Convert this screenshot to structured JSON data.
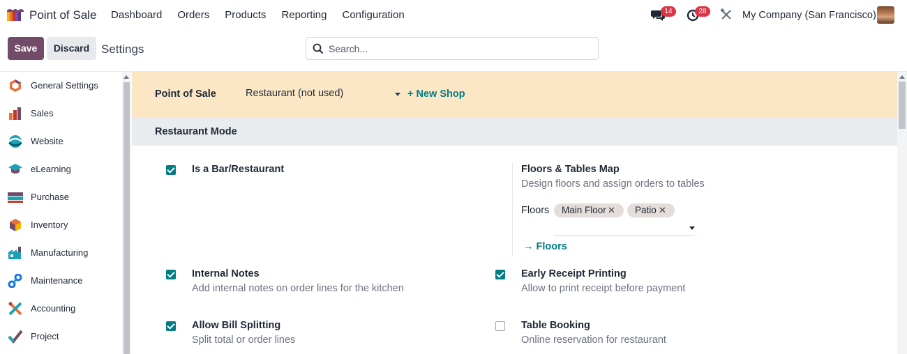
{
  "navbar": {
    "app_name": "Point of Sale",
    "menu": [
      "Dashboard",
      "Orders",
      "Products",
      "Reporting",
      "Configuration"
    ],
    "messages_count": "14",
    "activities_count": "28",
    "company": "My Company (San Francisco)"
  },
  "control": {
    "save_label": "Save",
    "discard_label": "Discard",
    "title": "Settings",
    "search_placeholder": "Search..."
  },
  "sidebar": {
    "items": [
      {
        "label": "General Settings",
        "icon": "general-settings-icon"
      },
      {
        "label": "Sales",
        "icon": "sales-icon"
      },
      {
        "label": "Website",
        "icon": "website-icon"
      },
      {
        "label": "eLearning",
        "icon": "elearning-icon"
      },
      {
        "label": "Purchase",
        "icon": "purchase-icon"
      },
      {
        "label": "Inventory",
        "icon": "inventory-icon"
      },
      {
        "label": "Manufacturing",
        "icon": "manufacturing-icon"
      },
      {
        "label": "Maintenance",
        "icon": "maintenance-icon"
      },
      {
        "label": "Accounting",
        "icon": "accounting-icon"
      },
      {
        "label": "Project",
        "icon": "project-icon"
      }
    ]
  },
  "shop": {
    "label": "Point of Sale",
    "selected": "Restaurant (not used)",
    "new_shop": "+ New Shop"
  },
  "section": {
    "title": "Restaurant Mode"
  },
  "options": {
    "bar_restaurant": {
      "title": "Is a Bar/Restaurant",
      "checked": true
    },
    "floors_map": {
      "title": "Floors & Tables Map",
      "desc": "Design floors and assign orders to tables",
      "floors_label": "Floors",
      "floors": [
        "Main Floor",
        "Patio"
      ],
      "floors_link": "Floors"
    },
    "internal_notes": {
      "title": "Internal Notes",
      "desc": "Add internal notes on order lines for the kitchen",
      "checked": true
    },
    "early_receipt": {
      "title": "Early Receipt Printing",
      "desc": "Allow to print receipt before payment",
      "checked": true
    },
    "bill_splitting": {
      "title": "Allow Bill Splitting",
      "desc": "Split total or order lines",
      "checked": true
    },
    "table_booking": {
      "title": "Table Booking",
      "desc": "Online reservation for restaurant",
      "checked": false
    }
  },
  "colors": {
    "brand": "#714b67",
    "accent": "#017e84",
    "badge": "#dc3545",
    "shop_bar": "#fbe7c6"
  }
}
